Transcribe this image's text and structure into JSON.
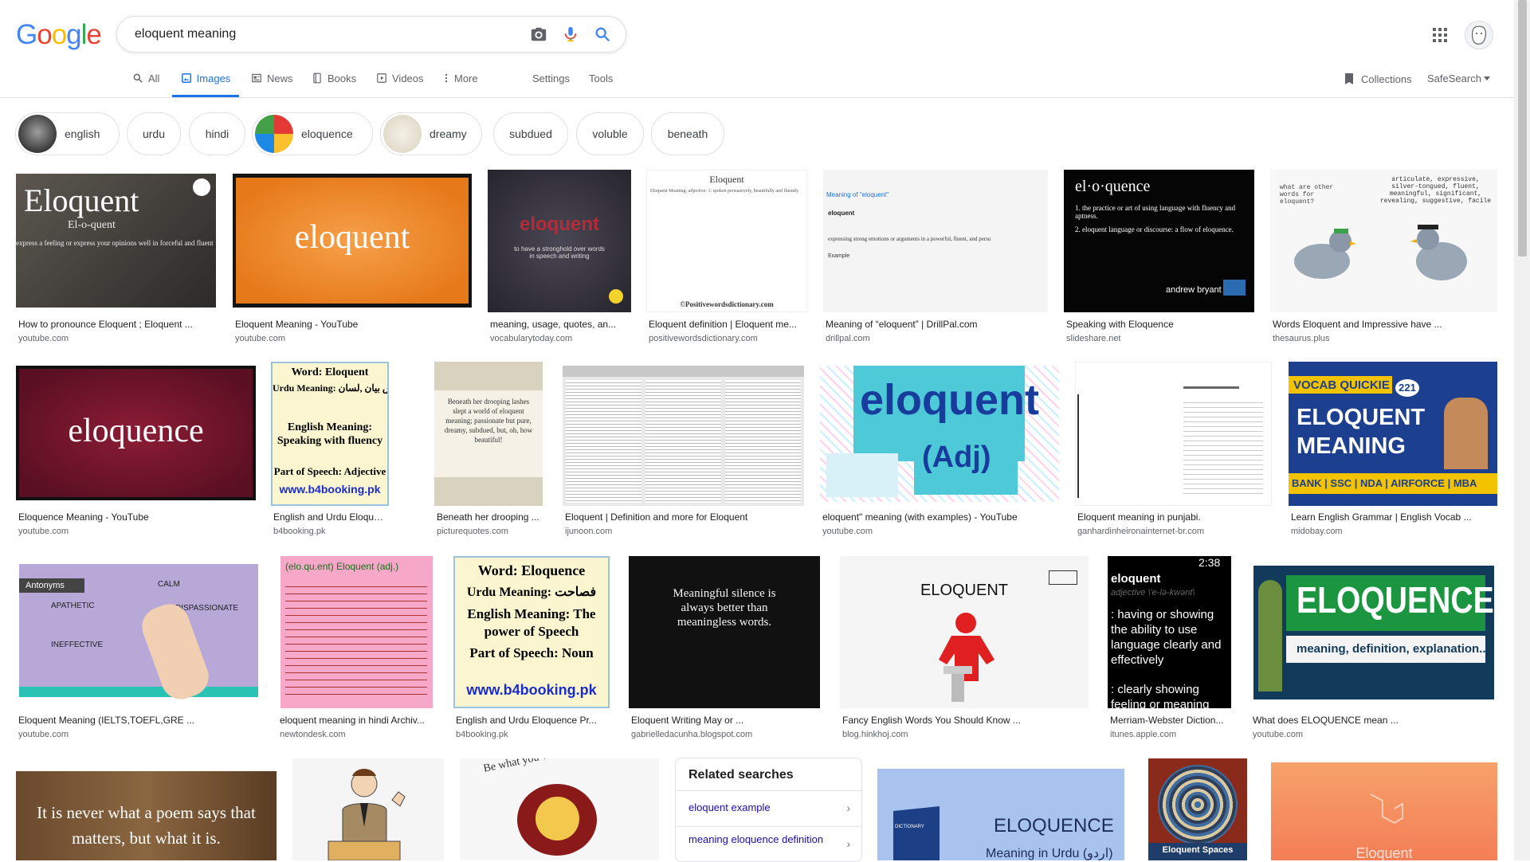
{
  "logo": "Google",
  "search": {
    "query": "eloquent meaning"
  },
  "tabs": [
    {
      "label": "All"
    },
    {
      "label": "Images"
    },
    {
      "label": "News"
    },
    {
      "label": "Books"
    },
    {
      "label": "Videos"
    },
    {
      "label": "More"
    }
  ],
  "settings_label": "Settings",
  "tools_label": "Tools",
  "collections_label": "Collections",
  "safesearch_label": "SafeSearch",
  "chips": [
    "english",
    "urdu",
    "hindi",
    "eloquence",
    "dreamy",
    "subdued",
    "voluble",
    "beneath"
  ],
  "results": [
    {
      "caption": "How to pronounce Eloquent ; Eloquent ...",
      "domain": "youtube.com",
      "text1": "Eloquent",
      "text2": "El-o-quent",
      "text3": "express a feeling or express your opinions well in forceful and fluent"
    },
    {
      "caption": "Eloquent Meaning - YouTube",
      "domain": "youtube.com",
      "text1": "eloquent"
    },
    {
      "caption": "meaning, usage, quotes, an...",
      "domain": "vocabularytoday.com",
      "text1": "eloquent",
      "text2": "to have a stronghold over words in speech and writing"
    },
    {
      "caption": "Eloquent definition | Eloquent me...",
      "domain": "positivewordsdictionary.com",
      "text1": "Eloquent",
      "text2": "Eloquent Meaning: adjective: 1: spoken persuasively, beautifully and fluently",
      "text3": "©Positivewordsdictionary.com"
    },
    {
      "caption": "Meaning of “eloquent” | DrillPal.com",
      "domain": "drillpal.com",
      "text1": "Meaning of \"eloquent\"",
      "text2": "eloquent",
      "text3": "expressing strong emotions or arguments in a powerful, fluent, and persu",
      "text4": "Example"
    },
    {
      "caption": "Speaking with Eloquence",
      "domain": "slideshare.net",
      "text1": "el·o·quence",
      "text2": "1. the practice or art of using language with fluency and aptness.",
      "text3": "2. eloquent language or discourse: a flow of eloquence.",
      "text4": "andrew bryant"
    },
    {
      "caption": "Words Eloquent and Impressive have ...",
      "domain": "thesaurus.plus",
      "text1": "what are other words for eloquent?",
      "text2": "articulate, expressive, silver-tongued, fluent, meaningful, significant, revealing, suggestive, facile"
    },
    {
      "caption": "Eloquence Meaning - YouTube",
      "domain": "youtube.com",
      "text1": "eloquence"
    },
    {
      "caption": "English and Urdu Eloquent P...",
      "domain": "b4booking.pk",
      "text1": "Word: Eloquent",
      "text2": "Urdu Meaning: خوش بیان ,لسان",
      "text3": "English Meaning: Speaking with fluency",
      "text4": "Part of Speech: Adjective",
      "text5": "www.b4booking.pk"
    },
    {
      "caption": "Beneath her drooping ...",
      "domain": "picturequotes.com",
      "text1": "Beneath her drooping lashes slept a world of eloquent meaning; passionate but pure, dreamy, subdued, but, oh, how beautiful!"
    },
    {
      "caption": "Eloquent | Definition and more for Eloquent",
      "domain": "ijunoon.com"
    },
    {
      "caption": "eloquent\" meaning (with examples) - YouTube",
      "domain": "youtube.com",
      "text1": "eloquent",
      "text2": "(Adj)"
    },
    {
      "caption": "Eloquent meaning in punjabi.",
      "domain": "ganhardinheironainternet-br.com"
    },
    {
      "caption": "Learn English Grammar | English Vocab ...",
      "domain": "midobay.com",
      "text1": "VOCAB QUICKIE",
      "text2": "221",
      "text3": "ELOQUENT MEANING",
      "text4": "BANK | SSC | NDA | AIRFORCE | MBA"
    },
    {
      "caption": "Eloquent Meaning (IELTS,TOEFL,GRE ...",
      "domain": "youtube.com",
      "text1": "Antonyms",
      "text2": "CALM",
      "text3": "APATHETIC",
      "text4": "DISPASSIONATE",
      "text5": "INEFFECTIVE"
    },
    {
      "caption": "eloquent meaning in hindi Archiv...",
      "domain": "newtondesk.com",
      "text1": "(elo.qu.ent) Eloquent (adj.)"
    },
    {
      "caption": "English and Urdu Eloquence Pr...",
      "domain": "b4booking.pk",
      "text1": "Word: Eloquence",
      "text2": "Urdu Meaning: فصاحت",
      "text3": "English Meaning: The power of Speech",
      "text4": "Part of Speech: Noun",
      "text5": "www.b4booking.pk"
    },
    {
      "caption": "Eloquent Writing May or ...",
      "domain": "gabrielledacunha.blogspot.com",
      "text1": "Meaningful silence is always better than meaningless words."
    },
    {
      "caption": "Fancy English Words You Should Know ...",
      "domain": "blog.hinkhoj.com",
      "text1": "ELOQUENT"
    },
    {
      "caption": "Merriam-Webster Diction...",
      "domain": "itunes.apple.com",
      "text1": "eloquent",
      "text2": "adjective \\'e-lə-kwənt\\",
      "text3": ": having or showing the ability to use language clearly and effectively",
      "text4": ": clearly showing feeling or meaning",
      "text5": "2:38"
    },
    {
      "caption": "What does ELOQUENCE mean ...",
      "domain": "youtube.com",
      "text1": "ELOQUENCE",
      "text2": "meaning, definition, explanation..."
    },
    {
      "text1": "It is never what a poem says that matters, but what it is."
    },
    {},
    {
      "text1": "Be what you want to be. Wear what you want to wear"
    },
    {
      "text1": "ELOQUENCE",
      "text2": "Meaning in Urdu (اردو)",
      "text3": "DICTIONARY"
    },
    {
      "text1": "Eloquent Spaces"
    },
    {
      "text1": "Eloquent"
    }
  ],
  "related": {
    "title": "Related searches",
    "items": [
      "eloquent example",
      "meaning eloquence definition"
    ]
  },
  "colors": {
    "accent": "#1a73e8",
    "link": "#1a0dab"
  }
}
